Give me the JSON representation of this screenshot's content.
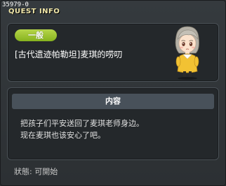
{
  "window": {
    "quest_id": "35979-0",
    "title": "QUEST INFO"
  },
  "header": {
    "category": "一般",
    "quest_name": "[古代遗迹帕勒坦]麦琪的唠叨",
    "npc_icon": "npc-portrait-girl"
  },
  "content": {
    "section_title": "内容",
    "description_lines": [
      "把孩子们平安送回了麦琪老师身边。",
      "现在麦琪也该安心了吧。"
    ]
  },
  "footer": {
    "status_text": "狀態:  可開始"
  },
  "colors": {
    "category_badge": "#9cc430",
    "title_text": "#f0e6a8",
    "section_header_bg": "#48515a"
  }
}
